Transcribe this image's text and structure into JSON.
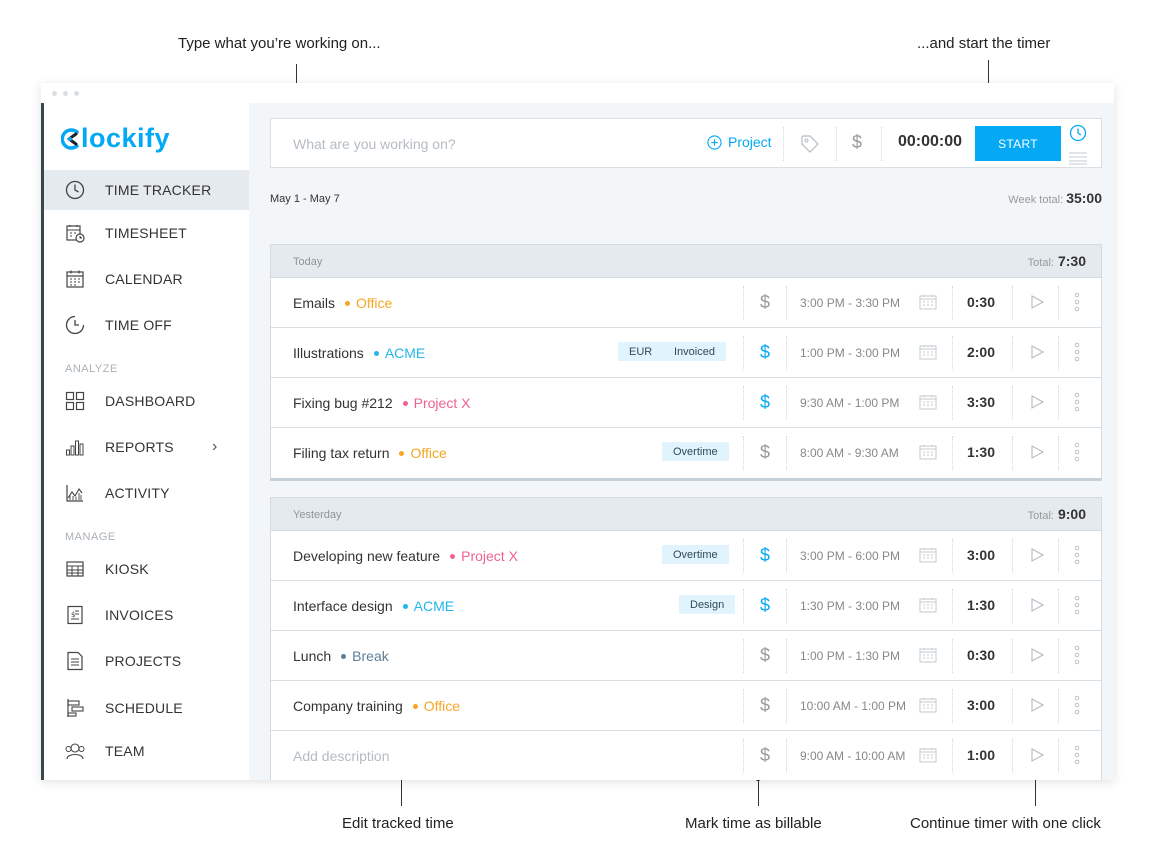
{
  "callouts": {
    "type": "Type what you’re working on...",
    "start": "...and start the timer",
    "edit": "Edit tracked time",
    "billable": "Mark time as billable",
    "continue": "Continue timer with one click"
  },
  "brand": {
    "name": "lockify",
    "accent": "#03a9f4"
  },
  "sidebar": {
    "items": [
      {
        "label": "TIME TRACKER",
        "icon": "clock-icon",
        "active": true
      },
      {
        "label": "TIMESHEET",
        "icon": "timesheet-icon"
      },
      {
        "label": "CALENDAR",
        "icon": "calendar-icon"
      },
      {
        "label": "TIME OFF",
        "icon": "time-off-icon"
      },
      {
        "label": "DASHBOARD",
        "icon": "dashboard-icon"
      },
      {
        "label": "REPORTS",
        "icon": "reports-icon",
        "arrow": "›"
      },
      {
        "label": "ACTIVITY",
        "icon": "activity-icon"
      },
      {
        "label": "KIOSK",
        "icon": "kiosk-icon"
      },
      {
        "label": "INVOICES",
        "icon": "invoices-icon"
      },
      {
        "label": "PROJECTS",
        "icon": "projects-icon"
      },
      {
        "label": "SCHEDULE",
        "icon": "schedule-icon"
      },
      {
        "label": "TEAM",
        "icon": "team-icon"
      }
    ],
    "sections": {
      "analyze": "ANALYZE",
      "manage": "MANAGE"
    }
  },
  "tracker": {
    "placeholder": "What are you working on?",
    "project_label": "Project",
    "timer": "00:00:00",
    "start_label": "START"
  },
  "week": {
    "range": "May 1 - May 7",
    "total_label": "Week total:",
    "total": "35:00"
  },
  "groups": [
    {
      "title": "Today",
      "total_label": "Total:",
      "total": "7:30",
      "entries": [
        {
          "desc": "Emails",
          "project": "Office",
          "color": "#f5a623",
          "tags": [],
          "billable": false,
          "time": "3:00 PM - 3:30 PM",
          "duration": "0:30"
        },
        {
          "desc": "Illustrations",
          "project": "ACME",
          "color": "#26b5e8",
          "tags": [
            "EUR",
            "Invoiced"
          ],
          "billable": true,
          "time": "1:00 PM - 3:00 PM",
          "duration": "2:00"
        },
        {
          "desc": "Fixing bug #212",
          "project": "Project X",
          "color": "#f06292",
          "tags": [],
          "billable": true,
          "time": "9:30 AM - 1:00 PM",
          "duration": "3:30"
        },
        {
          "desc": "Filing tax return",
          "project": "Office",
          "color": "#f5a623",
          "tags": [
            "Overtime"
          ],
          "billable": false,
          "time": "8:00 AM - 9:30 AM",
          "duration": "1:30"
        }
      ]
    },
    {
      "title": "Yesterday",
      "total_label": "Total:",
      "total": "9:00",
      "entries": [
        {
          "desc": "Developing new feature",
          "project": "Project X",
          "color": "#f06292",
          "tags": [
            "Overtime"
          ],
          "billable": true,
          "time": "3:00 PM - 6:00 PM",
          "duration": "3:00"
        },
        {
          "desc": "Interface design",
          "project": "ACME",
          "color": "#26b5e8",
          "tags": [
            "Design"
          ],
          "billable": true,
          "time": "1:30 PM - 3:00 PM",
          "duration": "1:30"
        },
        {
          "desc": "Lunch",
          "project": "Break",
          "color": "#5f7d95",
          "tags": [],
          "billable": false,
          "time": "1:00 PM - 1:30 PM",
          "duration": "0:30"
        },
        {
          "desc": "Company training",
          "project": "Office",
          "color": "#f5a623",
          "tags": [],
          "billable": false,
          "time": "10:00 AM - 1:00 PM",
          "duration": "3:00"
        },
        {
          "desc": "Add description",
          "project": "",
          "color": "",
          "tags": [],
          "billable": false,
          "time": "9:00 AM - 10:00 AM",
          "duration": "1:00",
          "placeholder": true
        }
      ]
    }
  ]
}
